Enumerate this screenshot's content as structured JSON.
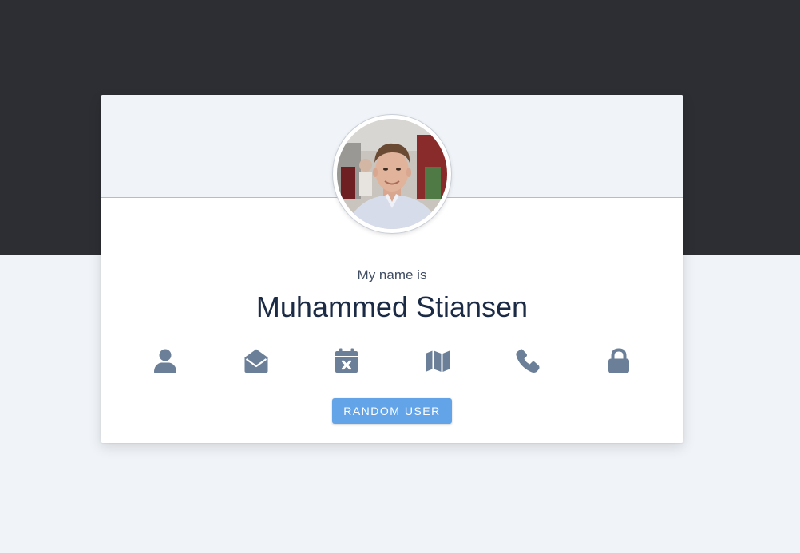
{
  "profile": {
    "label": "My name is",
    "name": "Muhammed Stiansen",
    "avatar_icon": "user-photo"
  },
  "icons": [
    {
      "name": "user-icon"
    },
    {
      "name": "envelope-open-icon"
    },
    {
      "name": "calendar-times-icon"
    },
    {
      "name": "map-icon"
    },
    {
      "name": "phone-icon"
    },
    {
      "name": "lock-icon"
    }
  ],
  "actions": {
    "random_user_label": "RANDOM USER"
  },
  "colors": {
    "page_bg": "#f0f4f8",
    "top_band": "#2d2e33",
    "card_bg": "#ffffff",
    "icon": "#6b7f99",
    "name_text": "#1c2b45",
    "label_text": "#3f4d63",
    "button_bg": "#63a4e9",
    "button_text": "#ffffff"
  }
}
